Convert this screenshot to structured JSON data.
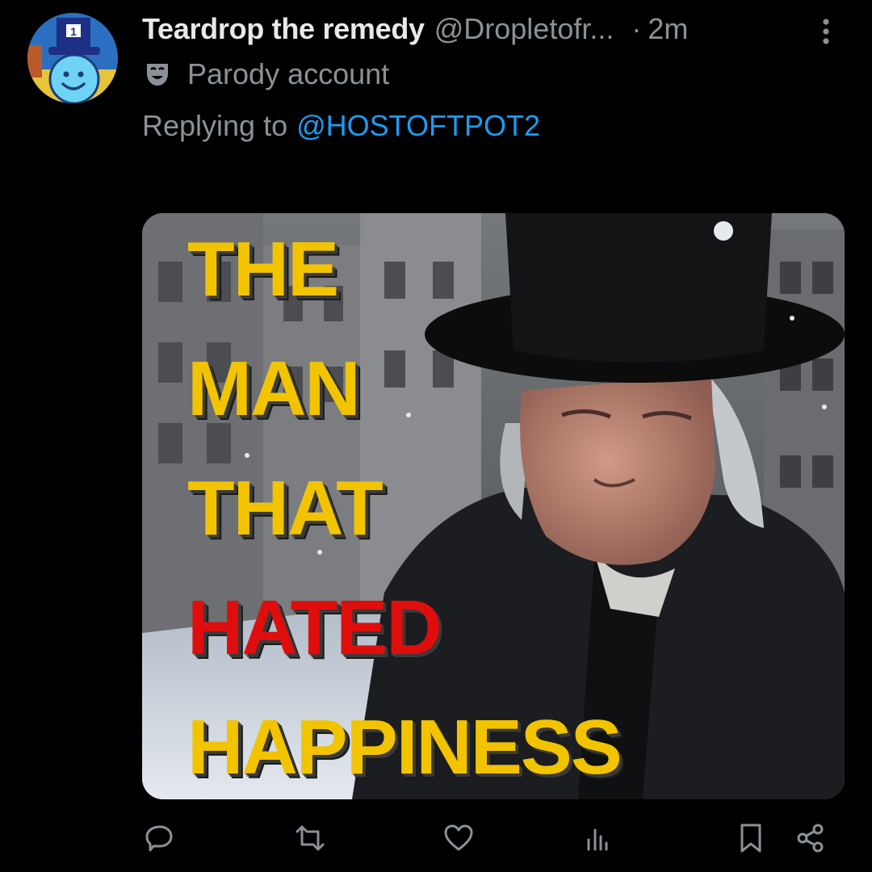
{
  "tweet": {
    "display_name": "Teardrop the remedy",
    "handle": "@Dropletofr...",
    "separator": "·",
    "time": "2m",
    "badge_text": "Parody account",
    "replying_prefix": "Replying to",
    "replying_handle": "@HOSTOFTPOT2",
    "media": {
      "lines": [
        "THE",
        "MAN",
        "THAT",
        "HATED",
        "HAPPINESS"
      ],
      "text_color": "#f2c400",
      "highlight_color": "#e00d0d",
      "highlight_line": "HATED"
    }
  },
  "actions": [
    {
      "name": "reply",
      "icon": "comment-icon"
    },
    {
      "name": "repost",
      "icon": "repost-icon"
    },
    {
      "name": "like",
      "icon": "heart-icon"
    },
    {
      "name": "views",
      "icon": "analytics-icon"
    },
    {
      "name": "bookmark",
      "icon": "bookmark-icon"
    },
    {
      "name": "share",
      "icon": "share-icon"
    }
  ],
  "colors": {
    "background": "#000000",
    "text": "#e7e9ea",
    "muted": "#8b9197",
    "link": "#1d9bf0"
  }
}
